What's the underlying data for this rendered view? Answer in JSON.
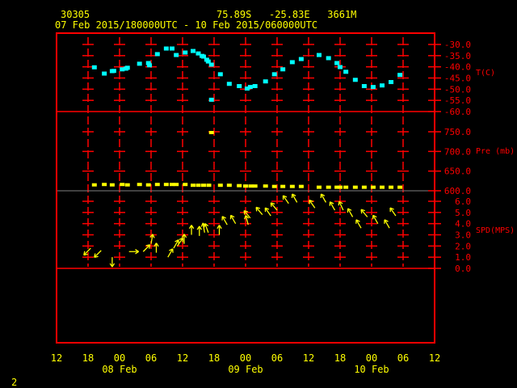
{
  "header": {
    "station": "30305",
    "location": "75.89S   -25.83E   3661M",
    "time_range": "07 Feb 2015/180000UTC - 10 Feb 2015/060000UTC"
  },
  "footer": {
    "page": "2"
  },
  "colors": {
    "frame": "#ff0000",
    "temperature": "#00ffff",
    "pressure": "#ffff00",
    "wind": "#ffff00",
    "text": "#ffff00",
    "separator": "#808080"
  },
  "chart_data": [
    {
      "type": "scatter",
      "title": "T(C)",
      "ylabel": "T(C)",
      "ylim": [
        -60,
        -30
      ],
      "yticks": [
        "-30.0",
        "-35.0",
        "-40.0",
        "-45.0",
        "-50.0",
        "-55.0",
        "-60.0"
      ],
      "ytick_values": [
        -30,
        -35,
        -40,
        -45,
        -50,
        -55,
        -60
      ],
      "x_unit": "hours since 07 Feb 2015 12UTC",
      "x": [
        7.2,
        9.1,
        10.6,
        10.9,
        12.5,
        13.2,
        13.5,
        15.8,
        17.5,
        17.7,
        19.2,
        20.9,
        22.0,
        22.8,
        24.5,
        26.0,
        27.0,
        27.7,
        28.0,
        28.6,
        28.9,
        29.5,
        29.5,
        31.2,
        32.9,
        34.8,
        36.3,
        36.9,
        37.8,
        39.8,
        41.5,
        43.1,
        44.9,
        46.6,
        50.0,
        51.8,
        53.4,
        54.0,
        55.1,
        56.9,
        58.6,
        60.3,
        62.0,
        63.7,
        65.4
      ],
      "y": [
        -40.4,
        -43.2,
        -42.1,
        -42.0,
        -41.3,
        -41.0,
        -40.6,
        -38.8,
        -38.5,
        -39.5,
        -34.5,
        -32.0,
        -32.0,
        -34.9,
        -33.8,
        -33.1,
        -34.2,
        -35.3,
        -35.6,
        -37.0,
        -37.8,
        -39.2,
        -54.9,
        -43.5,
        -47.8,
        -48.8,
        -49.9,
        -49.2,
        -48.8,
        -46.7,
        -43.5,
        -41.3,
        -38.1,
        -36.7,
        -34.9,
        -36.3,
        -38.5,
        -40.3,
        -42.4,
        -46.0,
        -48.8,
        -49.2,
        -48.5,
        -47.0,
        -43.8
      ]
    },
    {
      "type": "scatter",
      "title": "Pre (mb)",
      "ylabel": "Pre (mb)",
      "ylim": [
        600,
        750
      ],
      "yticks": [
        "750.0",
        "700.0",
        "650.0",
        "600.0"
      ],
      "ytick_values": [
        750,
        700,
        650,
        600
      ],
      "x_unit": "hours since 07 Feb 2015 12UTC",
      "x": [
        7.2,
        9.1,
        10.6,
        12.5,
        13.5,
        15.8,
        17.5,
        19.2,
        20.9,
        22.0,
        22.8,
        24.5,
        26.0,
        27.0,
        28.0,
        29.0,
        29.5,
        31.2,
        32.9,
        34.8,
        36.0,
        37.0,
        37.8,
        39.8,
        41.5,
        43.1,
        44.9,
        46.6,
        50.0,
        51.8,
        53.4,
        54.0,
        55.1,
        56.9,
        58.6,
        60.3,
        62.0,
        63.7,
        65.4
      ],
      "y": [
        615,
        616,
        615,
        616,
        615,
        616,
        615,
        616,
        616,
        616,
        616,
        616,
        614,
        614,
        614,
        614,
        748,
        614,
        614,
        613,
        612,
        612,
        612,
        612,
        611,
        611,
        611,
        611,
        609,
        609,
        609,
        609,
        609,
        609,
        609,
        609,
        609,
        609,
        609
      ]
    },
    {
      "type": "vector",
      "title": "SPD(MPS)",
      "ylabel": "SPD(MPS)",
      "ylim": [
        0,
        6
      ],
      "yticks": [
        "6.0",
        "5.0",
        "4.0",
        "3.0",
        "2.0",
        "1.0",
        "0.0"
      ],
      "ytick_values": [
        6,
        5,
        4,
        3,
        2,
        1,
        0
      ],
      "x_unit": "hours since 07 Feb 2015 12UTC",
      "x": [
        6.5,
        8.5,
        10.6,
        13.8,
        16.5,
        18.0,
        19.0,
        21.2,
        22.3,
        23.0,
        24.3,
        25.7,
        27.2,
        28.2,
        28.9,
        31.0,
        32.5,
        34.1,
        36.5,
        36.9,
        39.2,
        40.8,
        42.0,
        44.2,
        45.8,
        49.2,
        51.3,
        53.0,
        54.6,
        56.4,
        58.0,
        59.2,
        61.2,
        63.4,
        64.6
      ],
      "speed": [
        1.8,
        1.6,
        1.0,
        1.5,
        1.5,
        2.2,
        1.4,
        1.0,
        1.8,
        2.0,
        2.2,
        3.0,
        2.9,
        3.2,
        3.2,
        3.0,
        3.9,
        4.0,
        3.9,
        4.5,
        4.8,
        4.7,
        5.2,
        5.8,
        5.9,
        5.4,
        5.9,
        5.2,
        5.2,
        4.6,
        3.6,
        4.6,
        4.0,
        3.6,
        4.7
      ],
      "arrow_heading_deg": [
        225,
        225,
        180,
        90,
        45,
        10,
        0,
        30,
        30,
        35,
        0,
        0,
        0,
        350,
        340,
        0,
        330,
        330,
        345,
        320,
        320,
        325,
        320,
        325,
        330,
        325,
        330,
        330,
        335,
        330,
        330,
        320,
        330,
        330,
        325
      ]
    }
  ],
  "x_axis": {
    "hour_labels": [
      "12",
      "18",
      "00",
      "06",
      "12",
      "18",
      "00",
      "06",
      "12",
      "18",
      "00",
      "06",
      "12"
    ],
    "date_labels": [
      "08 Feb",
      "09 Feb",
      "10 Feb"
    ],
    "date_label_hours": [
      12,
      36,
      60
    ],
    "range_hours": [
      0,
      72
    ]
  }
}
